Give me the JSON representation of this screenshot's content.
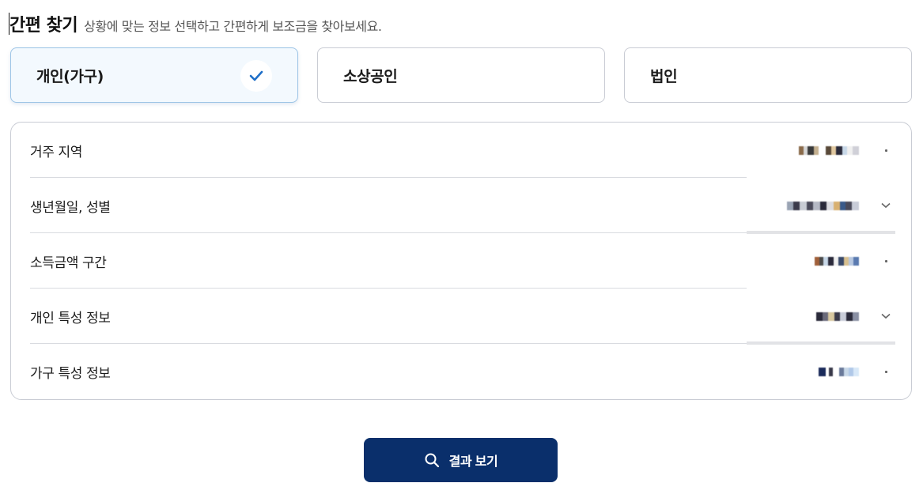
{
  "header": {
    "title": "간편 찾기",
    "subtitle": "상황에 맞는 정보 선택하고 간편하게 보조금을 찾아보세요."
  },
  "type_tabs": [
    {
      "label": "개인(가구)",
      "selected": true,
      "icon": "check-icon"
    },
    {
      "label": "소상공인",
      "selected": false
    },
    {
      "label": "법인",
      "selected": false
    }
  ],
  "filters": [
    {
      "label": "거주 지역",
      "value_redacted": true,
      "arrow": "dot"
    },
    {
      "label": "생년월일, 성별",
      "value_redacted": true,
      "arrow": "chevron-down-icon"
    },
    {
      "label": "소득금액 구간",
      "value_redacted": true,
      "arrow": "dot"
    },
    {
      "label": "개인 특성 정보",
      "value_redacted": true,
      "arrow": "chevron-down-icon"
    },
    {
      "label": "가구 특성 정보",
      "value_redacted": true,
      "arrow": "dot"
    }
  ],
  "actions": {
    "result_label": "결과 보기",
    "result_icon": "search-icon"
  },
  "colors": {
    "primary_button": "#0a2f6b",
    "selected_card_bg": "#f3f9fe",
    "check_color": "#1f6fc8",
    "border": "#c9ccd4"
  }
}
